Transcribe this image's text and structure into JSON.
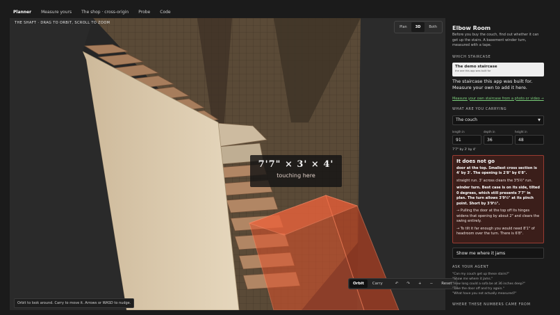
{
  "nav": {
    "tabs": [
      "Planner",
      "Measure yours",
      "The shop · cross-origin",
      "Probe",
      "Code"
    ],
    "active": 0
  },
  "viewport": {
    "caption": "The shaft · drag to orbit, scroll to zoom",
    "view_modes": [
      "Plan",
      "3D",
      "Both"
    ],
    "active_view": 1,
    "dims_readout": "7'7\" × 3' × 4'",
    "dims_sub": "touching here",
    "hint": "Orbit to look around. Carry to move it. Arrows or WASD to nudge.",
    "modes": [
      "Orbit",
      "Carry"
    ],
    "active_mode": 0,
    "controls": {
      "rotate_left": "↶",
      "rotate_right": "↷",
      "zoom_in": "+",
      "zoom_out": "−",
      "reset": "Reset"
    }
  },
  "panel": {
    "title": "Elbow Room",
    "subtitle": "Before you buy the couch, find out whether it can get up the stairs. A basement winder turn, measured with a tape.",
    "which_staircase": "Which staircase",
    "staircase_card": {
      "title": "The demo staircase",
      "sub": "the one this app was built for"
    },
    "staircase_desc": "The staircase this app was built for. Measure your own to add it here.",
    "measure_link": "Measure your own staircase from a photo or video →",
    "carrying_label": "What are you carrying",
    "carrying_value": "The couch",
    "fields": [
      {
        "label": "length in",
        "value": "91"
      },
      {
        "label": "depth in",
        "value": "36"
      },
      {
        "label": "height in",
        "value": "48"
      }
    ],
    "size_summary": "7'7\" by 3' by 4'",
    "verdict": {
      "title": "It does not go",
      "p1": "door at the top. Smallest cross section is 4' by 3'. The opening is 2'8\" by 6'8\".",
      "p2": "straight run. 3' across clears the 3'5½\" run.",
      "p3": "winder turn. Best case is on its side, tilted 0 degrees, which still presents 7'7\" in plan. The turn allows 3'9½\" at its pinch point. Short by 3'9½\".",
      "p4": "→ Pulling the door at the top off its hinges widens that opening by about 2\" and clears the swing entirely.",
      "p5": "→ To tilt it far enough you would need 8'1\" of headroom over the turn. There is 6'8\"."
    },
    "show_button": "Show me where it jams",
    "ask_agent": "Ask your agent",
    "agent_questions": [
      "\"Can my couch get up these stairs?\"",
      "\"Show me where it jams.\"",
      "\"How long could a sofa be at 36 inches deep?\"",
      "\"Take the door off and try again.\"",
      "\"What have you not actually measured?\""
    ],
    "numbers_from": "Where these numbers came from"
  },
  "colors": {
    "background": "#1b1b1b",
    "wall": "#d9c8ad",
    "tread": "#a07a5c",
    "couch": "#e0532c",
    "verdict_bg": "#3b1e1a",
    "link": "#7bd07b"
  }
}
